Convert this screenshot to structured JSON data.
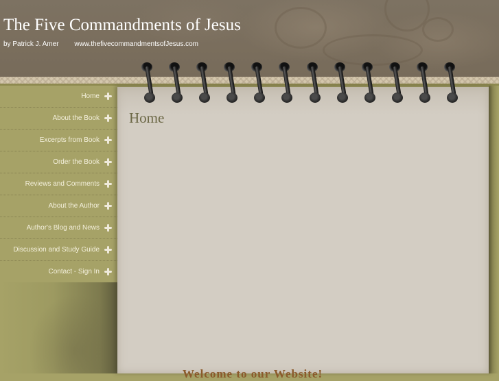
{
  "header": {
    "title": "The Five Commandments of Jesus",
    "author": "by Patrick J. Amer",
    "url": "www.thefivecommandmentsofJesus.com"
  },
  "nav": {
    "items": [
      {
        "label": "Home",
        "icon": "quatrefoil-icon"
      },
      {
        "label": "About the Book",
        "icon": "quatrefoil-icon"
      },
      {
        "label": "Excerpts from Book",
        "icon": "quatrefoil-icon"
      },
      {
        "label": "Order the Book",
        "icon": "quatrefoil-icon"
      },
      {
        "label": "Reviews and Comments",
        "icon": "quatrefoil-icon"
      },
      {
        "label": "About the Author",
        "icon": "quatrefoil-icon"
      },
      {
        "label": "Author's Blog and News",
        "icon": "quatrefoil-icon"
      },
      {
        "label": "Discussion and Study Guide",
        "icon": "quatrefoil-icon"
      },
      {
        "label": "Contact - Sign In",
        "icon": "quatrefoil-icon"
      }
    ]
  },
  "main": {
    "heading": "Home",
    "welcome": "Welcome to our Website!"
  },
  "colors": {
    "header_brown": "#7a6e5d",
    "olive": "#a6a267",
    "paper": "#d3cdc3",
    "heading_text": "#6b6745",
    "welcome_text": "#8b5a2b",
    "nav_text": "#f4f0dc"
  }
}
